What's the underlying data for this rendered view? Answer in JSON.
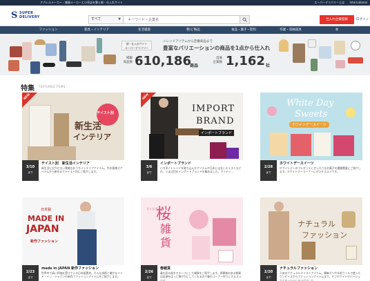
{
  "topbar": {
    "tagline": "アパレルメーカー・雑貨メーカーと小売店を繋ぐ卸・仕入れサイト",
    "links": [
      "スーパーデリバリーとは",
      "International"
    ]
  },
  "header": {
    "logo_line1": "SUPER",
    "logo_line2": "DELIVERY",
    "search_category": "すべて",
    "search_placeholder": "キーワード・企業名",
    "register_label": "仕入れ企業登録",
    "login_label": "ログイン"
  },
  "nav": {
    "items": [
      "ファッション",
      "家具・インテリア",
      "生活雑貨",
      "靴/ビ製品",
      "食品・菓子・飲料",
      "作業・収納道具",
      "本"
    ]
  },
  "hero": {
    "badge_line1": "卸・仕入れサイト",
    "badge_line2": "スーパーデリバリー",
    "lead_small": "トレンドアイテムから定番商品まで",
    "lead": "豊富なバリエーションの商品を1点から仕入れ",
    "items_label_1": "掲載",
    "items_label_2": "商品数",
    "items_value": "610,186",
    "items_unit": "商品",
    "companies_label_1": "出展",
    "companies_label_2": "企業数",
    "companies_value": "1,162",
    "companies_unit": "社"
  },
  "section": {
    "title": "特集",
    "subtitle": "FEATURED ITEMS"
  },
  "cards": [
    {
      "date": "3/10",
      "made": "まで",
      "title": "テイスト別　新生活インテリア",
      "desc": "新生活に欠かせない素敵なおうちインテリアアイテム。今お客様ズアイテムから新作までテイスト別にご紹介します。",
      "new_label": "NEW",
      "img_text_1": "テイスト別",
      "img_text_2": "新生活",
      "img_text_3": "インテリア"
    },
    {
      "date": "3/6",
      "made": "まで",
      "title": "インポートブランド",
      "desc": "いち早くトレンドを取り込んだアイテムや日本にはないテイストなどの、いま注目のインポートブランドを集めました。アイテッ...",
      "new_label": "NEW",
      "img_text_1": "IMPORT",
      "img_text_2": "BRAND",
      "img_text_3": "インポートブランド"
    },
    {
      "date": "2/28",
      "made": "まで",
      "title": "ホワイトデースイーツ",
      "desc": "ホワイトデーのプレゼントにぴったりなお菓子を種類豊富にご紹介します。ホワイトデーコーナーにぜひオススメです。",
      "img_text_1": "White Day",
      "img_text_2": "Sweets",
      "img_text_3": "ホワイトデースイーツ"
    },
    {
      "date": "2/23",
      "made": "まで",
      "title": "made in JAPAN 新作ファッション",
      "desc": "世界中で高い評価を受けている日本製素材。そんな技術と確かなメイド・イン・ジャパンの新作ファッションアイテムをご紹介します。",
      "img_text_1": "日本製",
      "img_text_2": "MADE IN",
      "img_text_3": "JAPAN",
      "img_text_4": "新作ファッション"
    },
    {
      "date": "2/26",
      "made": "まで",
      "title": "春雑貨",
      "desc": "春を彩る桜をモチーフにした雑貨をご紹介します。季節感のある雑貨は店頭をぱっと華やかにしてくれるので春のコーナー作りにオススメです。",
      "img_text_1": "桜",
      "img_text_2": "雑",
      "img_text_3": "貨",
      "img_text_4": "さくらざっか"
    },
    {
      "date": "2/20",
      "made": "まで",
      "title": "ナチュラルファッション",
      "desc": "人気のナチュラルテイストアイテム。綿麻ガリや羊毛ウールで使ったワンピースからファッションアイテムまで。オフホワイトやベージュでナチュラルに仕上げました。",
      "img_text_1": "ナチュラル",
      "img_text_2": "ファッション"
    }
  ]
}
